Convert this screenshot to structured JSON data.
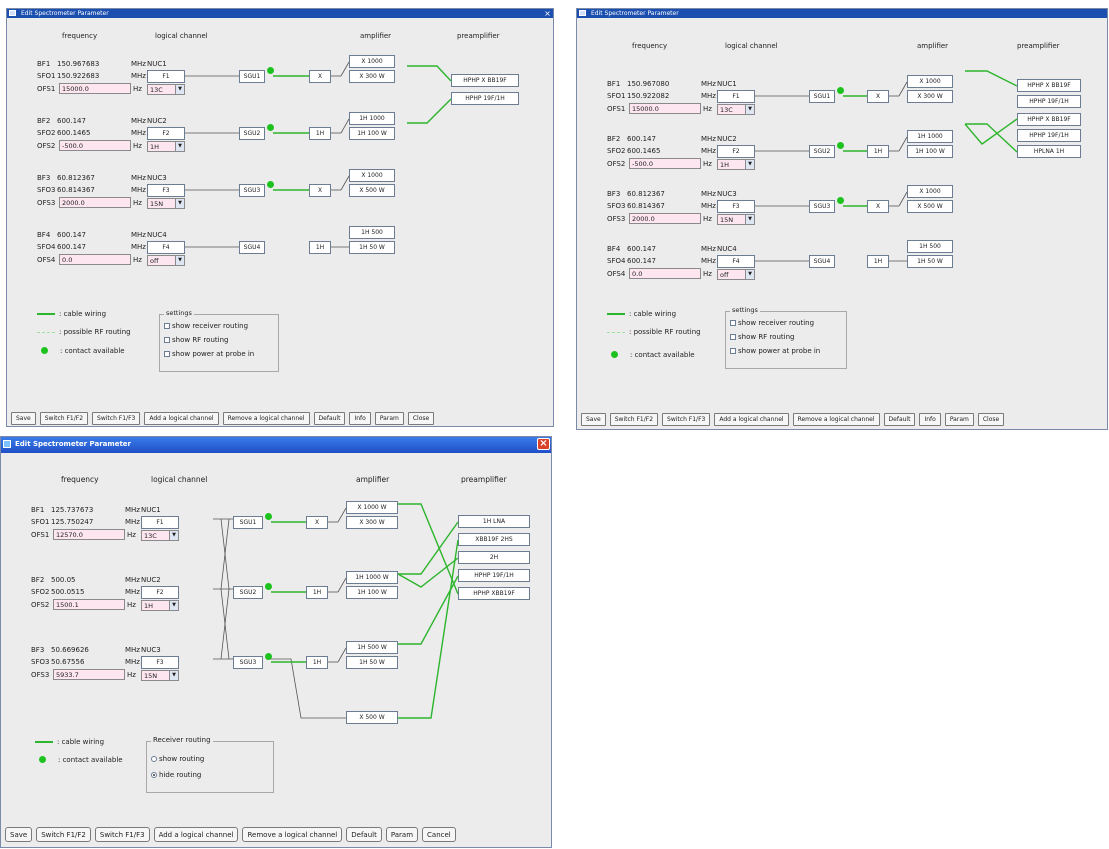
{
  "title": "Edit Spectrometer Parameter",
  "headers": {
    "frequency": "frequency",
    "logical_channel": "logical channel",
    "amplifier": "amplifier",
    "preamplifier": "preamplifier"
  },
  "panel1": {
    "rows": [
      {
        "bf": "BF1",
        "bf_val": "150.967683",
        "sfo": "SFO1",
        "sfo_val": "150.922683",
        "unit": "MHz",
        "ofs": "OFS1",
        "ofs_val": "15000.0",
        "hz": "Hz",
        "nuc": "NUC1",
        "f": "F1",
        "sel": "13C",
        "sgu": "SGU1",
        "amp_sm": "X",
        "amp_top": "X 1000",
        "amp_bot": "X 300 W"
      },
      {
        "bf": "BF2",
        "bf_val": "600.147",
        "sfo": "SFO2",
        "sfo_val": "600.1465",
        "unit": "MHz",
        "ofs": "OFS2",
        "ofs_val": "-500.0",
        "hz": "Hz",
        "nuc": "NUC2",
        "f": "F2",
        "sel": "1H",
        "sgu": "SGU2",
        "amp_sm": "1H",
        "amp_top": "1H 1000",
        "amp_bot": "1H 100 W"
      },
      {
        "bf": "BF3",
        "bf_val": "60.812367",
        "sfo": "SFO3",
        "sfo_val": "60.814367",
        "unit": "MHz",
        "ofs": "OFS3",
        "ofs_val": "2000.0",
        "hz": "Hz",
        "nuc": "NUC3",
        "f": "F3",
        "sel": "15N",
        "sgu": "SGU3",
        "amp_sm": "X",
        "amp_top": "X 1000",
        "amp_bot": "X 500 W"
      },
      {
        "bf": "BF4",
        "bf_val": "600.147",
        "sfo": "SFO4",
        "sfo_val": "600.147",
        "unit": "MHz",
        "ofs": "OFS4",
        "ofs_val": "0.0",
        "hz": "Hz",
        "nuc": "NUC4",
        "f": "F4",
        "sel": "off",
        "sgu": "SGU4",
        "amp_sm": "1H",
        "amp_top": "1H 500",
        "amp_bot": "1H 50 W"
      }
    ],
    "preamps": [
      "HPHP X BB19F",
      "HPHP 19F/1H"
    ],
    "legend": {
      "cable": ": cable wiring",
      "possible": ": possible RF routing",
      "contact": ": contact available"
    },
    "settings": {
      "title": "settings",
      "opt1": "show receiver routing",
      "opt2": "show RF routing",
      "opt3": "show power at probe in"
    },
    "buttons": [
      "Save",
      "Switch F1/F2",
      "Switch F1/F3",
      "Add a logical channel",
      "Remove a logical channel",
      "Default",
      "Info",
      "Param",
      "Close"
    ]
  },
  "panel2": {
    "rows": [
      {
        "bf": "BF1",
        "bf_val": "150.967080",
        "sfo": "SFO1",
        "sfo_val": "150.922082",
        "unit": "MHz",
        "ofs": "OFS1",
        "ofs_val": "15000.0",
        "hz": "Hz",
        "nuc": "NUC1",
        "f": "F1",
        "sel": "13C",
        "sgu": "SGU1",
        "amp_sm": "X",
        "amp_top": "X 1000",
        "amp_bot": "X 300 W"
      },
      {
        "bf": "BF2",
        "bf_val": "600.147",
        "sfo": "SFO2",
        "sfo_val": "600.1465",
        "unit": "MHz",
        "ofs": "OFS2",
        "ofs_val": "-500.0",
        "hz": "Hz",
        "nuc": "NUC2",
        "f": "F2",
        "sel": "1H",
        "sgu": "SGU2",
        "amp_sm": "1H",
        "amp_top": "1H 1000",
        "amp_bot": "1H 100 W"
      },
      {
        "bf": "BF3",
        "bf_val": "60.812367",
        "sfo": "SFO3",
        "sfo_val": "60.814367",
        "unit": "MHz",
        "ofs": "OFS3",
        "ofs_val": "2000.0",
        "hz": "Hz",
        "nuc": "NUC3",
        "f": "F3",
        "sel": "15N",
        "sgu": "SGU3",
        "amp_sm": "X",
        "amp_top": "X 1000",
        "amp_bot": "X 500 W"
      },
      {
        "bf": "BF4",
        "bf_val": "600.147",
        "sfo": "SFO4",
        "sfo_val": "600.147",
        "unit": "MHz",
        "ofs": "OFS4",
        "ofs_val": "0.0",
        "hz": "Hz",
        "nuc": "NUC4",
        "f": "F4",
        "sel": "off",
        "sgu": "SGU4",
        "amp_sm": "1H",
        "amp_top": "1H 500",
        "amp_bot": "1H 50 W"
      }
    ],
    "preamps": [
      "HPHP X BB19F",
      "HPHP 19F/1H",
      "HPHP X BB19F",
      "HPHP 19F/1H",
      "HPLNA 1H"
    ],
    "legend": {
      "cable": ": cable wiring",
      "possible": ": possible RF routing",
      "contact": ": contact available"
    },
    "settings": {
      "title": "settings",
      "opt1": "show receiver routing",
      "opt2": "show RF routing",
      "opt3": "show power at probe in"
    },
    "buttons": [
      "Save",
      "Switch F1/F2",
      "Switch F1/F3",
      "Add a logical channel",
      "Remove a logical channel",
      "Default",
      "Info",
      "Param",
      "Close"
    ]
  },
  "panel3": {
    "rows": [
      {
        "bf": "BF1",
        "bf_val": "125.737673",
        "sfo": "SFO1",
        "sfo_val": "125.750247",
        "unit": "MHz",
        "ofs": "OFS1",
        "ofs_val": "12570.0",
        "hz": "Hz",
        "nuc": "NUC1",
        "f": "F1",
        "sel": "13C",
        "sgu": "SGU1",
        "amp_sm": "X",
        "amp_top": "X 1000 W",
        "amp_bot": "X 300 W"
      },
      {
        "bf": "BF2",
        "bf_val": "500.05",
        "sfo": "SFO2",
        "sfo_val": "500.0515",
        "unit": "MHz",
        "ofs": "OFS2",
        "ofs_val": "1500.1",
        "hz": "Hz",
        "nuc": "NUC2",
        "f": "F2",
        "sel": "1H",
        "sgu": "SGU2",
        "amp_sm": "1H",
        "amp_top": "1H 1000 W",
        "amp_bot": "1H 100 W"
      },
      {
        "bf": "BF3",
        "bf_val": "50.669626",
        "sfo": "SFO3",
        "sfo_val": "50.67556",
        "unit": "MHz",
        "ofs": "OFS3",
        "ofs_val": "5933.7",
        "hz": "Hz",
        "nuc": "NUC3",
        "f": "F3",
        "sel": "15N",
        "sgu": "SGU3",
        "amp_sm": "1H",
        "amp_top": "1H 500 W",
        "amp_bot": "1H 50 W"
      }
    ],
    "extra_amp": "X 500 W",
    "preamps": [
      "1H LNA",
      "XBB19F 2HS",
      "2H",
      "HPHP 19F/1H",
      "HPHP XBB19F"
    ],
    "legend": {
      "cable": ": cable wiring",
      "contact": ": contact available"
    },
    "receiver": {
      "title": "Receiver routing",
      "opt1": "show routing",
      "opt2": "hide routing"
    },
    "buttons": [
      "Save",
      "Switch F1/F2",
      "Switch F1/F3",
      "Add a logical channel",
      "Remove a logical channel",
      "Default",
      "Param",
      "Cancel"
    ]
  },
  "colors": {
    "wire": "#2db52d",
    "titlebar": "#1a4fb0",
    "field": "#fde6ef"
  }
}
